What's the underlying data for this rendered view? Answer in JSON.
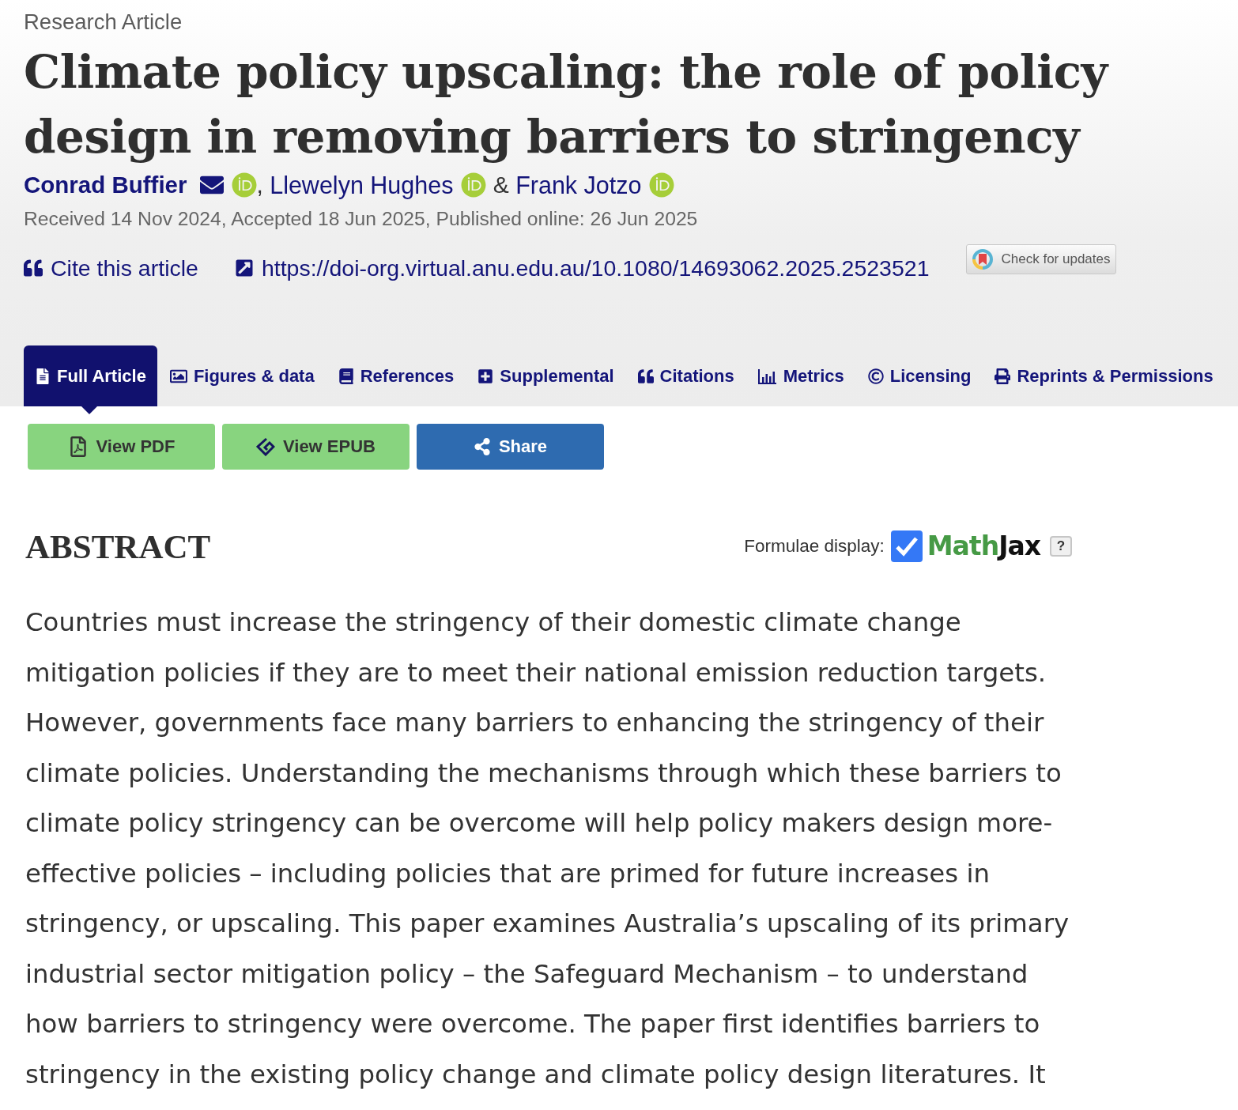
{
  "article_type": "Research Article",
  "title": "Climate policy upscaling: the role of policy design in removing barriers to stringency",
  "authors": [
    {
      "name": "Conrad Buffier",
      "corresponding": true,
      "orcid": true,
      "separator": ","
    },
    {
      "name": "Llewelyn Hughes",
      "corresponding": false,
      "orcid": true,
      "separator": "&"
    },
    {
      "name": "Frank Jotzo",
      "corresponding": false,
      "orcid": true
    }
  ],
  "dates": "Received 14 Nov 2024, Accepted 18 Jun 2025, Published online: 26 Jun 2025",
  "links": [
    {
      "kind": "cite",
      "label": "Cite this article"
    },
    {
      "kind": "doi",
      "label": "https://doi-org.virtual.anu.edu.au/10.1080/14693062.2025.2523521"
    }
  ],
  "updates_button": "Check for updates",
  "tabs": [
    {
      "kind": "article",
      "label": "Full Article",
      "selected": true
    },
    {
      "kind": "figures",
      "label": "Figures & data",
      "selected": false
    },
    {
      "kind": "references",
      "label": "References",
      "selected": false
    },
    {
      "kind": "supplemental",
      "label": "Supplemental",
      "selected": false
    },
    {
      "kind": "citations",
      "label": "Citations",
      "selected": false
    },
    {
      "kind": "metrics",
      "label": "Metrics",
      "selected": false
    },
    {
      "kind": "licensing",
      "label": "Licensing",
      "selected": false
    },
    {
      "kind": "reprints",
      "label": "Reprints & Permissions",
      "selected": false
    }
  ],
  "actions": [
    {
      "kind": "pdf",
      "label": "View PDF"
    },
    {
      "kind": "epub",
      "label": "View EPUB"
    },
    {
      "kind": "share",
      "label": "Share"
    }
  ],
  "abstract": {
    "heading": "ABSTRACT",
    "formulae": {
      "label": "Formulae display:",
      "checked": true,
      "logo": [
        "Math",
        "Jax"
      ],
      "help": "?"
    },
    "text": "Countries must increase the stringency of their domestic climate change mitigation policies if they are to meet their national emission reduction targets. However, governments face many barriers to enhancing the stringency of their climate policies. Understanding the mechanisms through which these barriers to climate policy stringency can be overcome will help policy makers design more-effective policies – including policies that are primed for future increases in stringency, or upscaling. This paper examines Australia’s upscaling of its primary industrial sector mitigation policy – the Safeguard Mechanism – to understand how barriers to stringency were overcome. The paper first identifies barriers to stringency in the existing policy change and climate policy design literatures. It"
  }
}
